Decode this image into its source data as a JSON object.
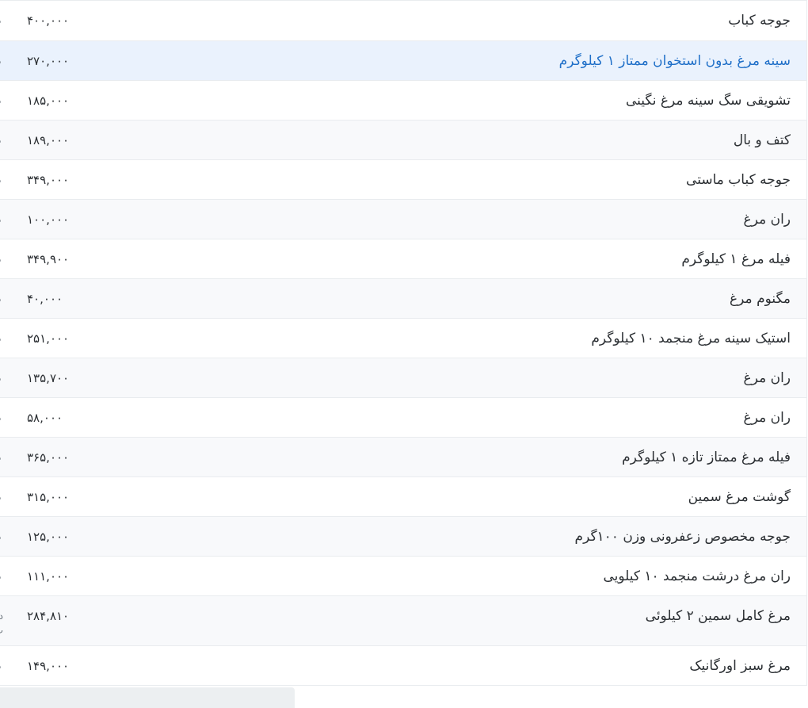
{
  "products": [
    {
      "name": "جوجه کباب",
      "price": "۴۰۰,۰۰۰",
      "unit": "د"
    },
    {
      "name": "سینه مرغ بدون استخوان ممتاز ۱ کیلوگرم",
      "price": "۲۷۰,۰۰۰",
      "unit": "د"
    },
    {
      "name": "تشویقی سگ سینه مرغ نگینی",
      "price": "۱۸۵,۰۰۰",
      "unit": "د"
    },
    {
      "name": "کتف و بال",
      "price": "۱۸۹,۰۰۰",
      "unit": "د"
    },
    {
      "name": "جوجه کباب ماستی",
      "price": "۳۴۹,۰۰۰",
      "unit": "د"
    },
    {
      "name": "ران مرغ",
      "price": "۱۰۰,۰۰۰",
      "unit": "د"
    },
    {
      "name": "فیله مرغ ۱ کیلوگرم",
      "price": "۳۴۹,۹۰۰",
      "unit": "د"
    },
    {
      "name": "مگنوم مرغ",
      "price": "۴۰,۰۰۰",
      "unit": "د"
    },
    {
      "name": "استیک سینه مرغ منجمد ۱۰ کیلوگرم",
      "price": "۲۵۱,۰۰۰",
      "unit": "د"
    },
    {
      "name": "ران مرغ",
      "price": "۱۳۵,۷۰۰",
      "unit": "د"
    },
    {
      "name": "ران مرغ",
      "price": "۵۸,۰۰۰",
      "unit": "د"
    },
    {
      "name": "فیله مرغ ممتاز تازه ۱ کیلوگرم",
      "price": "۳۶۵,۰۰۰",
      "unit": "د"
    },
    {
      "name": "گوشت مرغ سمین",
      "price": "۳۱۵,۰۰۰",
      "unit": "د"
    },
    {
      "name": "جوجه مخصوص زعفرونی وزن ۱۰۰گرم",
      "price": "۱۲۵,۰۰۰",
      "unit": "د"
    },
    {
      "name": "ران مرغ درشت منجمد ۱۰ کیلویی",
      "price": "۱۱۱,۰۰۰",
      "unit": "د"
    },
    {
      "name": "مرغ کامل سمین ۲ کیلوئی",
      "price": "۲۸۴,۸۱۰",
      "unit": "د پ"
    },
    {
      "name": "مرغ سبز اورگانیک",
      "price": "۱۴۹,۰۰۰",
      "unit": "د"
    }
  ]
}
